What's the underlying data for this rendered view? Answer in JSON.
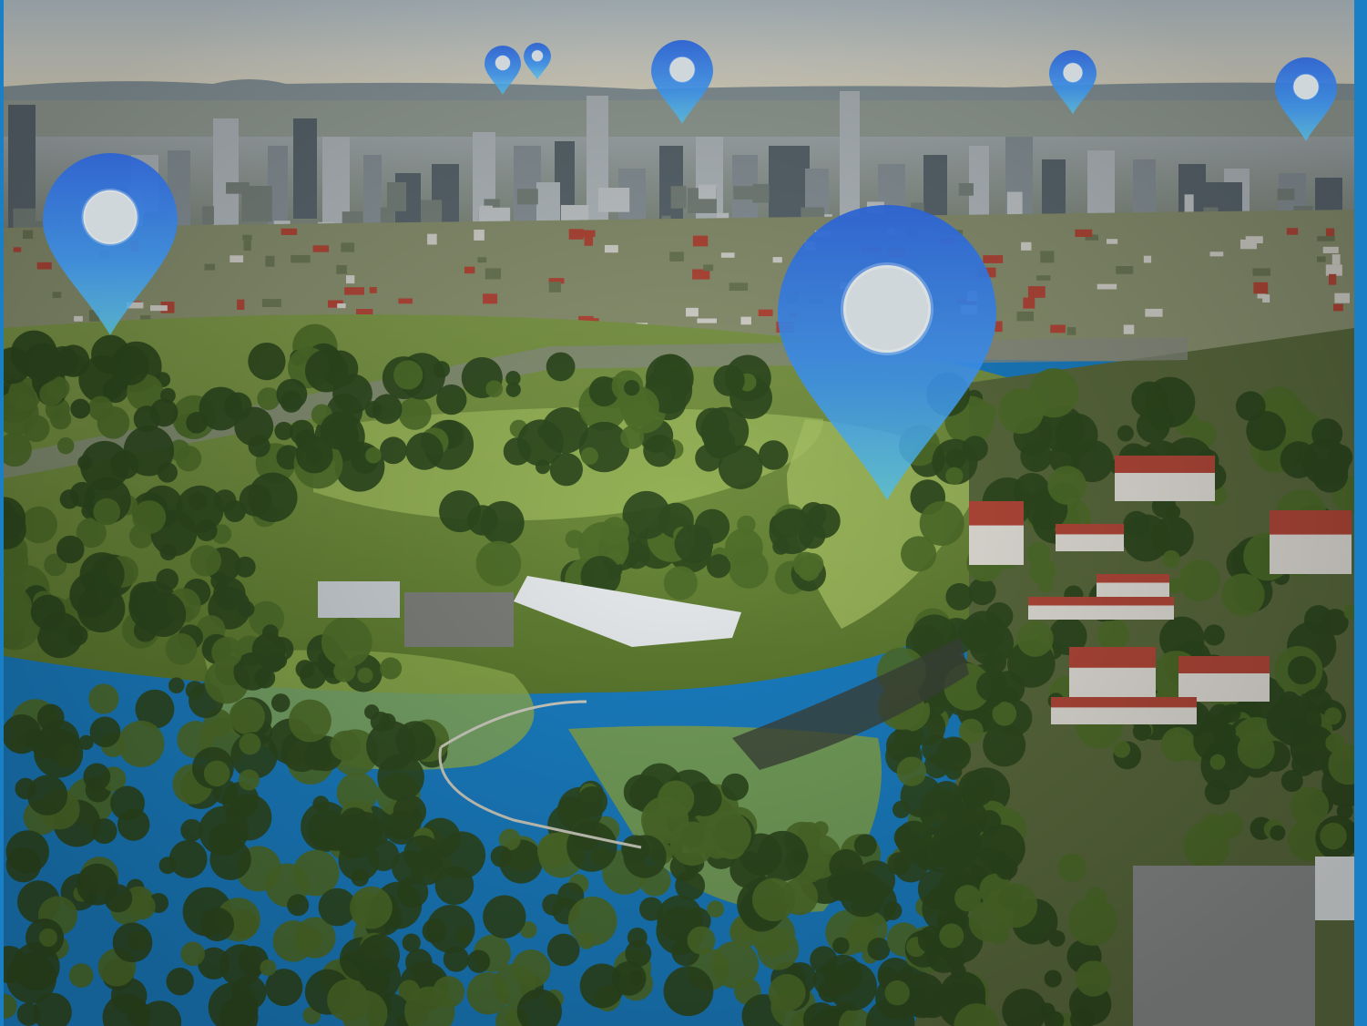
{
  "scene": {
    "description_free": true,
    "palette": {
      "frame": "#1a7fc4",
      "sky_top": "#c9d6dc",
      "sky_horizon": "#e8e3d2",
      "distant_hills": "#8fa0a6",
      "city": "#9aa6ad",
      "city_dark": "#5d6970",
      "grass_light": "#9cb85a",
      "grass_dark": "#5f7c33",
      "trees": "#2f4a1f",
      "trees_light": "#4f6f2a",
      "roof_red": "#b5493a",
      "pin_top": "#2f6fd6",
      "pin_bottom": "#41b2ee"
    }
  },
  "pins": [
    {
      "name": "pin-large-center",
      "size": "large"
    },
    {
      "name": "pin-left",
      "size": "medium"
    },
    {
      "name": "pin-top-center",
      "size": "small"
    },
    {
      "name": "pin-top-left-a",
      "size": "tiny"
    },
    {
      "name": "pin-top-left-b",
      "size": "tiny"
    },
    {
      "name": "pin-top-right-a",
      "size": "small"
    },
    {
      "name": "pin-top-right-b",
      "size": "small"
    }
  ]
}
